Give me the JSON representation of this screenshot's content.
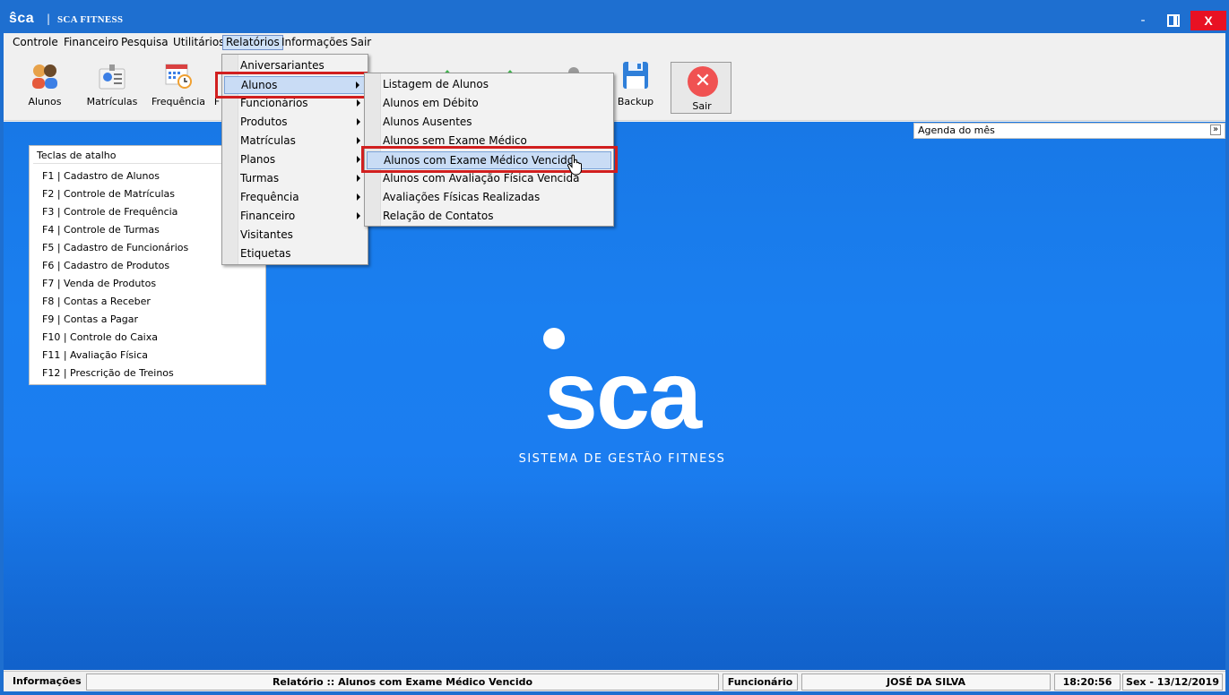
{
  "titlebar": {
    "logo": "ŝca",
    "separator": "|",
    "title": "SCA FITNESS",
    "minimize": "-",
    "close": "X"
  },
  "menubar": [
    "Controle",
    "Financeiro",
    "Pesquisa",
    "Utilitários",
    "Relatórios",
    "Informações",
    "Sair"
  ],
  "toolbar": {
    "buttons": [
      {
        "label": "Alunos",
        "icon": "students-icon"
      },
      {
        "label": "Matrículas",
        "icon": "enrollment-icon"
      },
      {
        "label": "Frequência",
        "icon": "calendar-clock-icon"
      },
      {
        "label": "F",
        "icon": "partial-icon"
      },
      {
        "label": "Backup",
        "icon": "floppy-disk-icon"
      },
      {
        "label": "Sair",
        "icon": "close-circle-icon"
      }
    ]
  },
  "agenda": {
    "label": "Agenda do mês"
  },
  "shortcuts": {
    "header": "Teclas de atalho",
    "items": [
      "F1 | Cadastro de Alunos",
      "F2 | Controle de Matrículas",
      "F3 | Controle de Frequência",
      "F4 | Controle de Turmas",
      "F5 | Cadastro de Funcionários",
      "F6 | Cadastro de Produtos",
      "F7 | Venda de Produtos",
      "F8 | Contas a Receber",
      "F9 | Contas a Pagar",
      "F10 | Controle do Caixa",
      "F11 | Avaliação Física",
      "F12 | Prescrição de Treinos"
    ]
  },
  "brand": {
    "word": "sca",
    "tagline": "SISTEMA DE GESTÃO FITNESS"
  },
  "relatorios_menu": [
    "Aniversariantes",
    "Alunos",
    "Funcionários",
    "Produtos",
    "Matrículas",
    "Planos",
    "Turmas",
    "Frequência",
    "Financeiro",
    "Visitantes",
    "Etiquetas"
  ],
  "alunos_submenu": [
    "Listagem de Alunos",
    "Alunos em Débito",
    "Alunos Ausentes",
    "Alunos sem Exame Médico",
    "Alunos com Exame Médico Vencido",
    "Alunos com Avaliação Física Vencida",
    "Avaliações Físicas Realizadas",
    "Relação de Contatos"
  ],
  "statusbar": {
    "info_label": "Informações",
    "report": "Relatório :: Alunos com Exame Médico Vencido",
    "role_label": "Funcionário",
    "user": "JOSÉ DA SILVA",
    "time": "18:20:56",
    "date": "Sex - 13/12/2019"
  },
  "colors": {
    "brand_blue": "#1e6fd0",
    "highlight_red": "#d11f1f",
    "close_red": "#e81123"
  }
}
